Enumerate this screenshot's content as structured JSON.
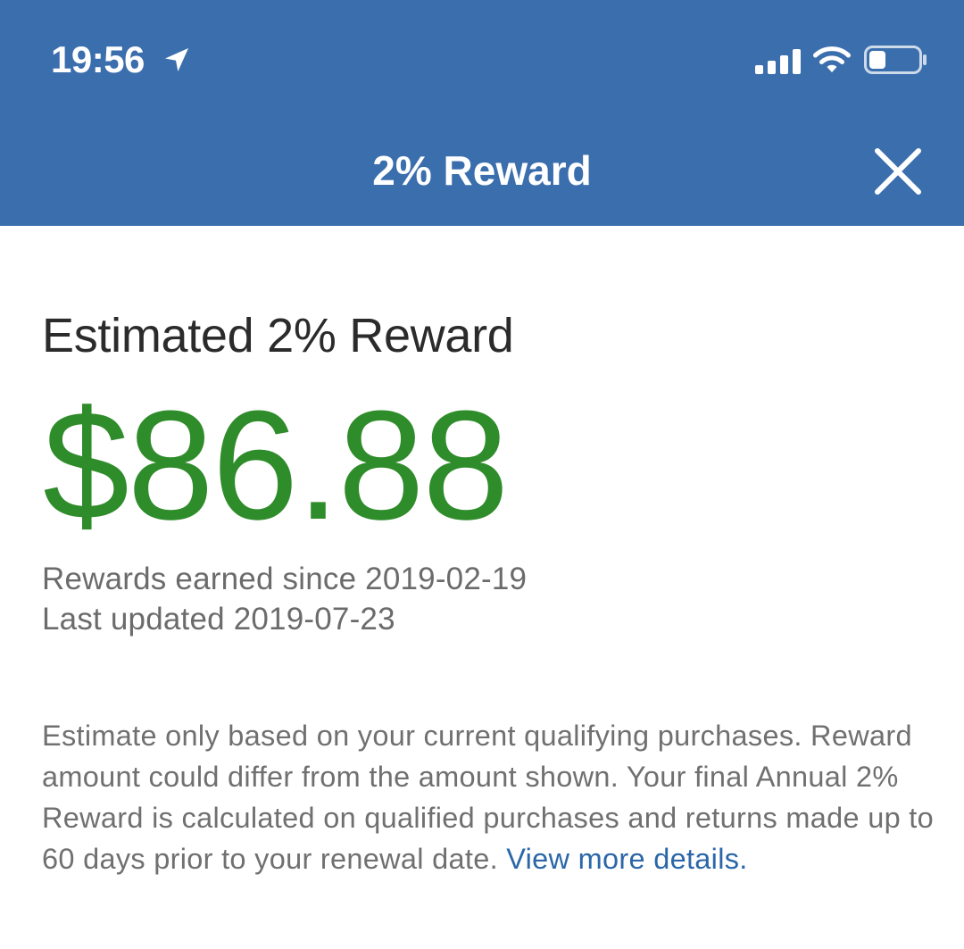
{
  "status_bar": {
    "time": "19:56",
    "icons": [
      "location-arrow-icon",
      "cellular-signal-icon",
      "wifi-icon",
      "battery-icon"
    ]
  },
  "nav": {
    "title": "2% Reward",
    "close_icon": "close-icon"
  },
  "reward": {
    "heading": "Estimated 2% Reward",
    "amount": "$86.88",
    "earned_since": "Rewards earned since 2019-02-19",
    "last_updated": "Last updated 2019-07-23",
    "disclaimer": "Estimate only based on your current qualifying purchases. Reward amount could differ from the amount shown. Your final Annual 2% Reward is calculated on qualified purchases and returns made up to 60 days prior to your renewal date.",
    "details_link": "View more details."
  },
  "colors": {
    "header_blue": "#3b6ead",
    "amount_green": "#2f8c2a",
    "link_blue": "#2b67a8"
  }
}
